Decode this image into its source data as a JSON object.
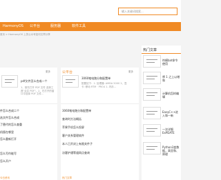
{
  "header": {
    "search_placeholder": "输入关键词搜索..."
  },
  "nav": {
    "items": [
      "HarmonyOS",
      "公平台",
      "服务器",
      "软件工具"
    ]
  },
  "breadcrumb": "首页 > HarmonyOS 上的公众号如何文章分享",
  "left_panel": {
    "more": "更多",
    "feature_title": "pdf文件怎么合成一个",
    "feature_desc": "1、首先打开 PDF 文件 选择工具\"合并 PDF\"。2、在打开的窗口中选择 PDF 文件...",
    "list": [
      "件怎么合成二个",
      "选文件怎么合成",
      "了替代的怎么查重",
      "机版在哪里",
      "怎么重新打开",
      "怎么写作能写",
      "怎么开户"
    ]
  },
  "mid_panel": {
    "title": "公平台",
    "more": "更多",
    "feature_title": "3060笔电跑分和配置单",
    "feature_desc": "配置如下：1. 处理器: AMDA 5000 2、显卡: 移动 RTM · PRO4 1. 内存...",
    "list": [
      "3060笔电跑分和配置单",
      "查询时方法概括",
      "苹果手机怎么投屏",
      "客户关系管理软件",
      "本人已开封上有限关件子",
      "访客护通等道网点查询"
    ]
  },
  "side": {
    "title": "热门文章",
    "items": [
      "符模bat命令使用",
      "将 1 之上以增和",
      "计算机怎样编辑",
      "EasyC++进入和一新",
      "一次详细ExPDATE",
      "Python3变数据，高亚和、原理"
    ]
  },
  "bottom": {
    "left_label": "今日资讯",
    "mid_label": "热门文章"
  }
}
